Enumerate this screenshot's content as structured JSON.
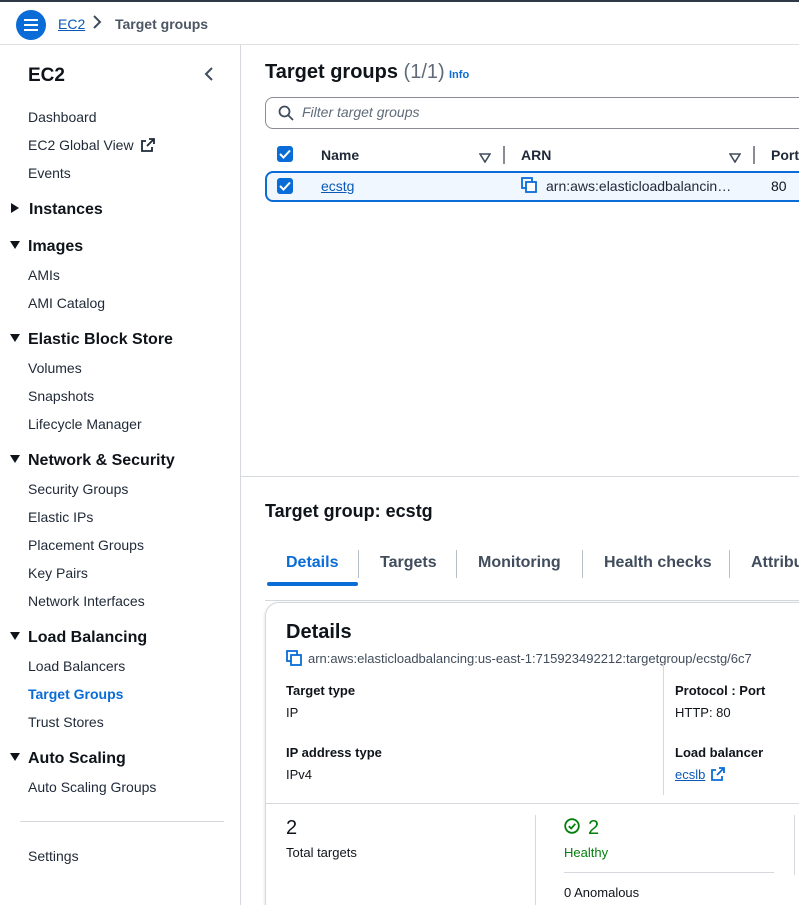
{
  "breadcrumb": {
    "root": "EC2",
    "current": "Target groups"
  },
  "sidebar": {
    "title": "EC2",
    "top_items": [
      "Dashboard",
      "EC2 Global View",
      "Events"
    ],
    "sections": [
      {
        "label": "Instances",
        "expanded": false,
        "items": []
      },
      {
        "label": "Images",
        "expanded": true,
        "items": [
          "AMIs",
          "AMI Catalog"
        ]
      },
      {
        "label": "Elastic Block Store",
        "expanded": true,
        "items": [
          "Volumes",
          "Snapshots",
          "Lifecycle Manager"
        ]
      },
      {
        "label": "Network & Security",
        "expanded": true,
        "items": [
          "Security Groups",
          "Elastic IPs",
          "Placement Groups",
          "Key Pairs",
          "Network Interfaces"
        ]
      },
      {
        "label": "Load Balancing",
        "expanded": true,
        "items": [
          "Load Balancers",
          "Target Groups",
          "Trust Stores"
        ]
      },
      {
        "label": "Auto Scaling",
        "expanded": true,
        "items": [
          "Auto Scaling Groups"
        ]
      }
    ],
    "active_item": "Target Groups",
    "footer_item": "Settings"
  },
  "page": {
    "title": "Target groups",
    "count": "(1/1)",
    "info_label": "Info",
    "filter_placeholder": "Filter target groups"
  },
  "table": {
    "columns": [
      "Name",
      "ARN",
      "Port"
    ],
    "rows": [
      {
        "name": "ecstg",
        "arn": "arn:aws:elasticloadbalancin…",
        "port": "80",
        "selected": true
      }
    ]
  },
  "detail": {
    "title": "Target group: ecstg",
    "tabs": [
      "Details",
      "Targets",
      "Monitoring",
      "Health checks",
      "Attribu"
    ],
    "active_tab": "Details",
    "card_title": "Details",
    "arn": "arn:aws:elasticloadbalancing:us-east-1:715923492212:targetgroup/ecstg/6c7",
    "target_type_label": "Target type",
    "target_type": "IP",
    "ip_type_label": "IP address type",
    "ip_type": "IPv4",
    "protocol_label": "Protocol : Port",
    "protocol": "HTTP: 80",
    "lb_label": "Load balancer",
    "lb": "ecslb",
    "total_targets": "2",
    "total_targets_label": "Total targets",
    "healthy": "2",
    "healthy_label": "Healthy",
    "anomalous": "0 Anomalous"
  },
  "colors": {
    "accent": "#0a6cd6",
    "link": "#0a59b8",
    "healthy": "#037f0c"
  }
}
